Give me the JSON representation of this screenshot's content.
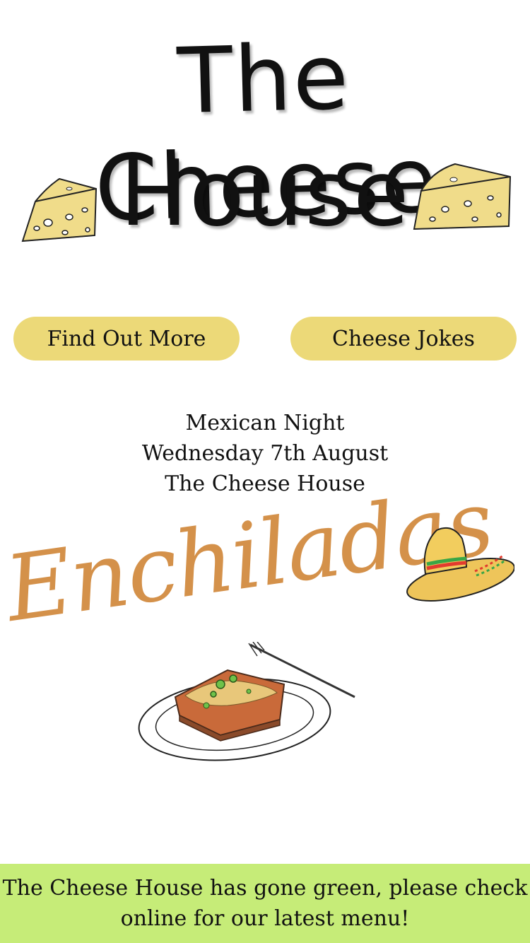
{
  "header": {
    "title_line1": "The Cheese",
    "title_line2": "House",
    "cheese_icon": "cheese-wedge-icon"
  },
  "buttons": {
    "find_out_more": "Find Out More",
    "cheese_jokes": "Cheese Jokes"
  },
  "event": {
    "name": "Mexican Night",
    "date": "Wednesday 7th August",
    "venue": "The Cheese House"
  },
  "feature": {
    "dish": "Enchiladas",
    "hat_icon": "sombrero-icon",
    "plate_icon": "enchilada-plate-icon"
  },
  "footer": {
    "notice": "The Cheese House has gone green, please check online for our latest menu!"
  },
  "colors": {
    "button_bg": "#ecd978",
    "footer_bg": "#c6ec78",
    "enchiladas_text": "#d4914a",
    "cheese": "#f0dc8a"
  }
}
